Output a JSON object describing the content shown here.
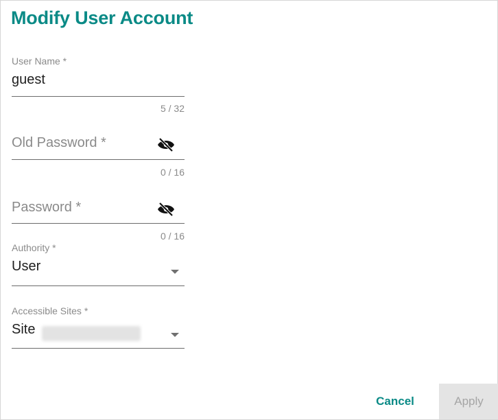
{
  "dialog": {
    "title": "Modify User Account"
  },
  "fields": {
    "username": {
      "label": "User Name *",
      "value": "guest",
      "counter": "5 / 32"
    },
    "old_password": {
      "placeholder": "Old Password *",
      "counter": "0 / 16",
      "toggle_icon": "eye-off-icon"
    },
    "password": {
      "placeholder": "Password *",
      "counter": "0 / 16",
      "toggle_icon": "eye-off-icon"
    },
    "authority": {
      "label": "Authority *",
      "value": "User",
      "dropdown_icon": "caret-down-icon"
    },
    "accessible_sites": {
      "label": "Accessible Sites *",
      "value": "Site",
      "dropdown_icon": "caret-down-icon"
    }
  },
  "actions": {
    "cancel_label": "Cancel",
    "apply_label": "Apply"
  },
  "colors": {
    "accent": "#0a8a86",
    "disabled_bg": "#e4e4e4",
    "disabled_text": "#a5a5a5"
  }
}
